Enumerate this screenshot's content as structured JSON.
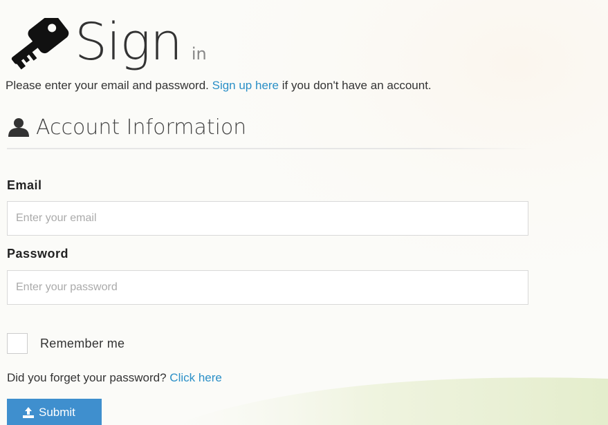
{
  "header": {
    "title": "Sign",
    "subtitle": "in"
  },
  "intro": {
    "text_before": "Please enter your email and password. ",
    "signup_link": "Sign up here",
    "text_after": " if you don't have an account."
  },
  "section": {
    "title": "Account Information",
    "icon": "user-icon"
  },
  "form": {
    "email_label": "Email",
    "email_placeholder": "Enter your email",
    "email_value": "",
    "password_label": "Password",
    "password_placeholder": "Enter your password",
    "password_value": "",
    "remember_label": "Remember me",
    "remember_checked": false,
    "forgot_text": "Did you forget your password? ",
    "forgot_link": "Click here",
    "submit_label": "Submit"
  },
  "colors": {
    "link": "#2a8fc7",
    "button": "#3f8fce",
    "background_swoosh": "#eef3dc"
  }
}
